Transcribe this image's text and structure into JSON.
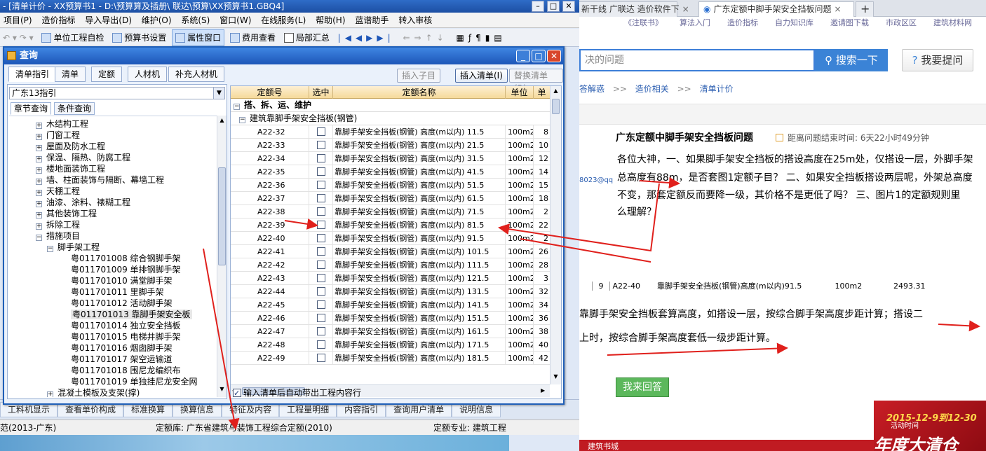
{
  "app": {
    "title": "- [清单计价 - XX预算书1 - D:\\预算算及插册\\ 联达\\预算\\XX预算书1.GBQ4]",
    "menu": [
      "项目(P)",
      "造价指标",
      "导入导出(D)",
      "维护(O)",
      "系统(S)",
      "窗口(W)",
      "在线服务(L)",
      "帮助(H)",
      "蓝谱助手",
      "转入审核"
    ],
    "toolbar": [
      "单位工程自检",
      "预算书设置",
      "属性窗口",
      "费用查看",
      "局部汇总"
    ],
    "bottom_tabs": [
      "工料机显示",
      "查看单价构成",
      "标准换算",
      "换算信息",
      "特征及内容",
      "工程量明细",
      "内容指引",
      "查询用户清单",
      "说明信息"
    ],
    "status": {
      "spec": "范(2013-广东)",
      "quota_lib": "定额库: 广东省建筑与装饰工程综合定额(2010)",
      "quota_major": "定额专业: 建筑工程"
    }
  },
  "dialog": {
    "title": "查询",
    "tabs": [
      "清单指引",
      "清单",
      "定额",
      "人材机",
      "补充人材机"
    ],
    "buttons": {
      "insert_child": "插入子目",
      "insert_list": "插入清单(I)",
      "replace_list": "替换清单(R)"
    },
    "combo": "广东13指引",
    "subtabs": [
      "章节查询",
      "条件查询"
    ],
    "tree": [
      {
        "label": "木结构工程",
        "level": 1,
        "expander": "+"
      },
      {
        "label": "门窗工程",
        "level": 1,
        "expander": "+"
      },
      {
        "label": "屋面及防水工程",
        "level": 1,
        "expander": "+"
      },
      {
        "label": "保温、隔热、防腐工程",
        "level": 1,
        "expander": "+"
      },
      {
        "label": "楼地面装饰工程",
        "level": 1,
        "expander": "+"
      },
      {
        "label": "墙、柱面装饰与隔断、幕墙工程",
        "level": 1,
        "expander": "+"
      },
      {
        "label": "天棚工程",
        "level": 1,
        "expander": "+"
      },
      {
        "label": "油漆、涂料、裱糊工程",
        "level": 1,
        "expander": "+"
      },
      {
        "label": "其他装饰工程",
        "level": 1,
        "expander": "+"
      },
      {
        "label": "拆除工程",
        "level": 1,
        "expander": "+"
      },
      {
        "label": "措施项目",
        "level": 1,
        "expander": "−"
      },
      {
        "label": "脚手架工程",
        "level": 2,
        "expander": "−"
      },
      {
        "label": "粤011701008  综合钢脚手架",
        "level": 3
      },
      {
        "label": "粤011701009  单排钢脚手架",
        "level": 3
      },
      {
        "label": "粤011701010  满堂脚手架",
        "level": 3
      },
      {
        "label": "粤011701011  里脚手架",
        "level": 3
      },
      {
        "label": "粤011701012  活动脚手架",
        "level": 3
      },
      {
        "label": "粤011701013  靠脚手架安全板",
        "level": 3,
        "selected": true
      },
      {
        "label": "粤011701014  独立安全挡板",
        "level": 3
      },
      {
        "label": "粤011701015  电梯井脚手架",
        "level": 3
      },
      {
        "label": "粤011701016  烟囱脚手架",
        "level": 3
      },
      {
        "label": "粤011701017  架空运输道",
        "level": 3
      },
      {
        "label": "粤011701018  围尼龙编织布",
        "level": 3
      },
      {
        "label": "粤011701019  单独挂尼龙安全网",
        "level": 3
      },
      {
        "label": "混凝土模板及支架(撑)",
        "level": 2,
        "expander": "+"
      }
    ],
    "grid": {
      "headers": [
        "定额号",
        "选中",
        "定额名称",
        "单位",
        "单"
      ],
      "groups": [
        "搭、拆、运、维护",
        "建筑靠脚手架安全挡板(钢管)"
      ],
      "rows": [
        {
          "code": "A22-32",
          "name": "靠脚手架安全挡板(钢管) 高度(m以内) 11.5",
          "unit": "100m2",
          "price": "8"
        },
        {
          "code": "A22-33",
          "name": "靠脚手架安全挡板(钢管) 高度(m以内) 21.5",
          "unit": "100m2",
          "price": "10"
        },
        {
          "code": "A22-34",
          "name": "靠脚手架安全挡板(钢管) 高度(m以内) 31.5",
          "unit": "100m2",
          "price": "12"
        },
        {
          "code": "A22-35",
          "name": "靠脚手架安全挡板(钢管) 高度(m以内) 41.5",
          "unit": "100m2",
          "price": "14"
        },
        {
          "code": "A22-36",
          "name": "靠脚手架安全挡板(钢管) 高度(m以内) 51.5",
          "unit": "100m2",
          "price": "15"
        },
        {
          "code": "A22-37",
          "name": "靠脚手架安全挡板(钢管) 高度(m以内) 61.5",
          "unit": "100m2",
          "price": "18"
        },
        {
          "code": "A22-38",
          "name": "靠脚手架安全挡板(钢管) 高度(m以内) 71.5",
          "unit": "100m2",
          "price": "2"
        },
        {
          "code": "A22-39",
          "name": "靠脚手架安全挡板(钢管) 高度(m以内) 81.5",
          "unit": "100m2",
          "price": "22"
        },
        {
          "code": "A22-40",
          "name": "靠脚手架安全挡板(钢管) 高度(m以内) 91.5",
          "unit": "100m2",
          "price": "2"
        },
        {
          "code": "A22-41",
          "name": "靠脚手架安全挡板(钢管) 高度(m以内) 101.5",
          "unit": "100m2",
          "price": "26"
        },
        {
          "code": "A22-42",
          "name": "靠脚手架安全挡板(钢管) 高度(m以内) 111.5",
          "unit": "100m2",
          "price": "28"
        },
        {
          "code": "A22-43",
          "name": "靠脚手架安全挡板(钢管) 高度(m以内) 121.5",
          "unit": "100m2",
          "price": "3"
        },
        {
          "code": "A22-44",
          "name": "靠脚手架安全挡板(钢管) 高度(m以内) 131.5",
          "unit": "100m2",
          "price": "32"
        },
        {
          "code": "A22-45",
          "name": "靠脚手架安全挡板(钢管) 高度(m以内) 141.5",
          "unit": "100m2",
          "price": "34"
        },
        {
          "code": "A22-46",
          "name": "靠脚手架安全挡板(钢管) 高度(m以内) 151.5",
          "unit": "100m2",
          "price": "36"
        },
        {
          "code": "A22-47",
          "name": "靠脚手架安全挡板(钢管) 高度(m以内) 161.5",
          "unit": "100m2",
          "price": "38"
        },
        {
          "code": "A22-48",
          "name": "靠脚手架安全挡板(钢管) 高度(m以内) 171.5",
          "unit": "100m2",
          "price": "40"
        },
        {
          "code": "A22-49",
          "name": "靠脚手架安全挡板(钢管) 高度(m以内) 181.5",
          "unit": "100m2",
          "price": "42"
        }
      ]
    },
    "auto_check": "输入清单后自动带出工程内容行"
  },
  "browser": {
    "tabs": [
      "新干线 广联达 造价软件下",
      "广东定额中脚手架安全挡板问题"
    ],
    "top_links": [
      "《注联书》",
      "算法入门",
      "造价指标",
      "自力知识库",
      "邀请图下载",
      "市政区区",
      "建筑材料网"
    ],
    "search_placeholder": "决的问题",
    "search_button": "搜索一下",
    "ask_button": "我要提问",
    "breadcrumb": [
      "答解惑",
      "造价相关",
      "清单计价"
    ],
    "question": {
      "title": "广东定额中脚手架安全挡板问题",
      "time": "距离问题结束时间: 6天22小时49分钟",
      "user": "8023@qq",
      "lines": [
        "各位大神，一、如果脚手架安全挡板的搭设高度在25m处，仅搭设一层，外脚手架",
        "总高度有88m，是否套图1定额子目？ 二、如果安全挡板搭设两层呢，外架总高度",
        "不变，那套定额反而要降一级，其价格不是更低了吗？ 三、图片1的定额规则里",
        "么理解？"
      ]
    },
    "ref_row": {
      "idx": "9",
      "code": "A22-40",
      "name": "靠脚手架安全挡板(钢管)高度(m以内)91.5",
      "unit": "100m2",
      "price": "2493.31"
    },
    "answer_lines": [
      "靠脚手架安全挡板套算高度，如搭设一层，按综合脚手架高度步距计算；搭设二",
      "上时，按综合脚手架高度套低一级步距计算。"
    ],
    "reply_button": "我来回答",
    "ad": {
      "date": "2015-12-9到12-30",
      "sub": "活动时间",
      "headline": "年度大清仓",
      "store": "建筑书城"
    }
  },
  "colors": {
    "arrow": "#e0201c",
    "dialog_title": "#1d56b8",
    "search_button": "#3b83d6",
    "reply_button": "#5cb85c"
  }
}
